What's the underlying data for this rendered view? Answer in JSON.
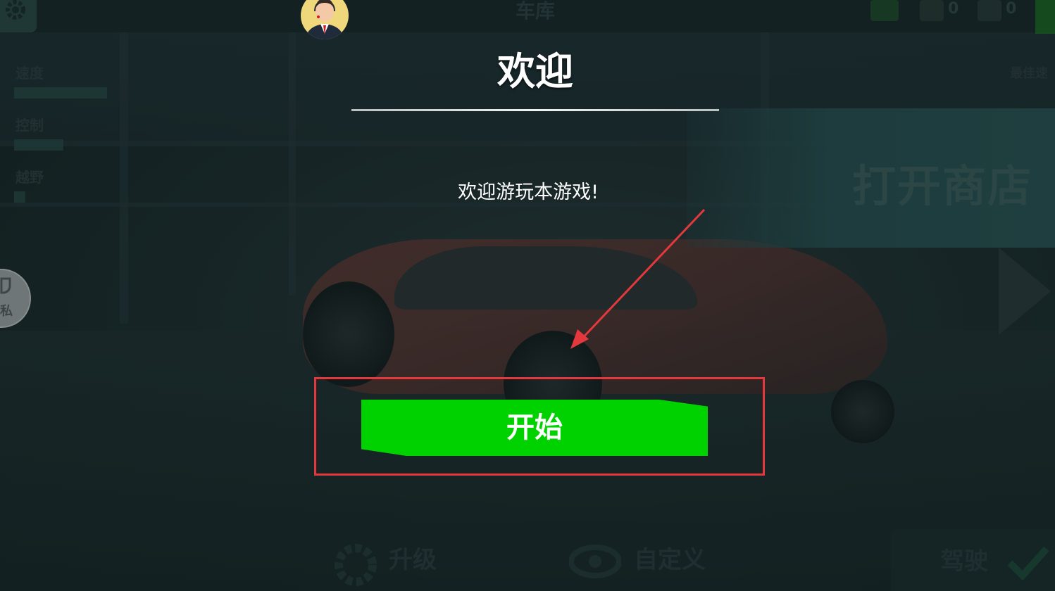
{
  "top_bar": {
    "title": "车库",
    "currency_cash": "0",
    "currency_gems": "0"
  },
  "stats": [
    {
      "label": "速度",
      "fill": 0.6
    },
    {
      "label": "控制",
      "fill": 0.35
    },
    {
      "label": "越野",
      "fill": 0.08
    }
  ],
  "best_label": "最佳速",
  "shop": {
    "label": "打开商店"
  },
  "privacy": {
    "label": "私"
  },
  "bottom_bar": {
    "upgrade_label": "升级",
    "customize_label": "自定义",
    "drive_label": "驾驶"
  },
  "dialog": {
    "title": "欢迎",
    "message": "欢迎游玩本游戏!",
    "start_label": "开始"
  },
  "colors": {
    "start_button": "#00d200",
    "annotation": "#e4393c",
    "avatar_bg": "#efd77b"
  }
}
